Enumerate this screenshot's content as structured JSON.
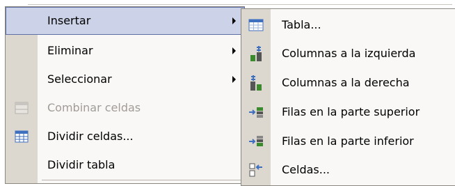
{
  "main_menu": {
    "items": [
      {
        "label": "Insertar",
        "state": "highlighted",
        "has_submenu": true,
        "icon": ""
      },
      {
        "label": "Eliminar",
        "state": "normal",
        "has_submenu": true,
        "icon": ""
      },
      {
        "label": "Seleccionar",
        "state": "normal",
        "has_submenu": true,
        "icon": ""
      },
      {
        "label": "Combinar celdas",
        "state": "disabled",
        "has_submenu": false,
        "icon": "merge-cells-icon"
      },
      {
        "label": "Dividir celdas...",
        "state": "normal",
        "has_submenu": false,
        "icon": "split-cells-icon"
      },
      {
        "label": "Dividir tabla",
        "state": "normal",
        "has_submenu": false,
        "icon": ""
      }
    ]
  },
  "insert_submenu": {
    "items": [
      {
        "label": "Tabla...",
        "icon": "insert-table-icon"
      },
      {
        "label": "Columnas a la izquierda",
        "icon": "insert-columns-left-icon"
      },
      {
        "label": "Columnas a la derecha",
        "icon": "insert-columns-right-icon"
      },
      {
        "label": "Filas en la parte superior",
        "icon": "insert-rows-above-icon"
      },
      {
        "label": "Filas en la parte inferior",
        "icon": "insert-rows-below-icon"
      },
      {
        "label": "Celdas...",
        "icon": "insert-cells-icon"
      }
    ]
  },
  "colors": {
    "menu_background": "#f9f8f7",
    "gutter": "#dcd8d0",
    "highlight": "#ccd3e8",
    "highlight_border": "#5d6fa5",
    "disabled_text": "#a09c97",
    "icon_blue": "#3f6fbf",
    "icon_green": "#3c8a2e"
  }
}
